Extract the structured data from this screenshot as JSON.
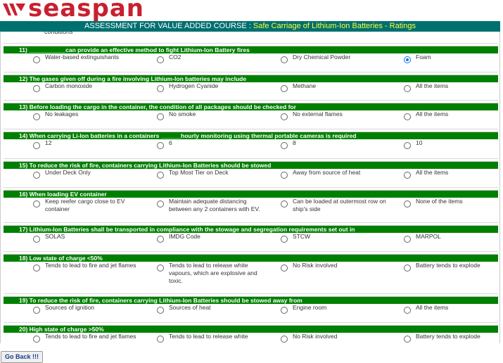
{
  "brand": {
    "logo_text": "seaspan",
    "color": "#c8202f"
  },
  "header": {
    "prefix": "ASSESSMENT FOR VALUE ADDED COURSE : ",
    "course": "Safe Carriage of Lithium-Ion Batteries - Ratings"
  },
  "clipped_text": "conditions",
  "questions": [
    {
      "text": "11) ___________can provide an effective method to fight Lithium-Ion Battery fires",
      "options": [
        "Water-based extinguishants",
        "CO2",
        "Dry Chemical Powder",
        "Foam"
      ],
      "selected": 3
    },
    {
      "text": "12) The gases given off during a fire involving Lithium-Ion batteries may include",
      "options": [
        "Carbon monoxide",
        "Hydrogen Cyanide",
        "Methane",
        "All the items"
      ],
      "selected": null
    },
    {
      "text": "13) Before loading the cargo in the container, the condition of all packages should be checked for",
      "options": [
        "No leakages",
        "No smoke",
        "No external flames",
        "All the items"
      ],
      "selected": null
    },
    {
      "text": "14) When carrying Li-Ion batteries in a containers ______hourly monitoring using thermal portable cameras is required",
      "options": [
        "12",
        "6",
        "8",
        "10"
      ],
      "selected": null
    },
    {
      "text": "15) To reduce the risk of fire, containers carrying Lithium-Ion Batteries should be stowed",
      "options": [
        "Under Deck Only",
        "Top Most Tier on Deck",
        "Away from source of heat",
        "All the items"
      ],
      "selected": null
    },
    {
      "text": "16) When loading EV container",
      "options": [
        "Keep reefer cargo close to EV container",
        "Maintain adequate distancing between any 2 containers with EV.",
        "Can be loaded at outermost row on ship's side",
        "None of the items"
      ],
      "selected": null
    },
    {
      "text": "17) Lithium-Ion Batteries shall be transported in compliance with the stowage and segregation requirements set out in",
      "options": [
        "SOLAS",
        "IMDG Code",
        "STCW",
        "MARPOL"
      ],
      "selected": null
    },
    {
      "text": "18) Low state of charge <50%",
      "options": [
        "Tends to lead to fire and jet flames",
        "Tends to lead to release white vapours, which are explosive and toxic.",
        "No Risk involved",
        "Battery tends to explode"
      ],
      "selected": null
    },
    {
      "text": "19) To reduce the risk of fire, containers carrying Lithium-Ion Batteries should be stowed away from",
      "options": [
        "Sources of ignition",
        "Sources of heat",
        "Engine room",
        "All the items"
      ],
      "selected": null
    },
    {
      "text": "20) High state of charge >50%",
      "options": [
        "Tends to lead to fire and jet flames",
        "Tends to lead to release white",
        "No Risk involved",
        "Battery tends to explode"
      ],
      "selected": null
    }
  ],
  "go_back_label": "Go Back !!!"
}
